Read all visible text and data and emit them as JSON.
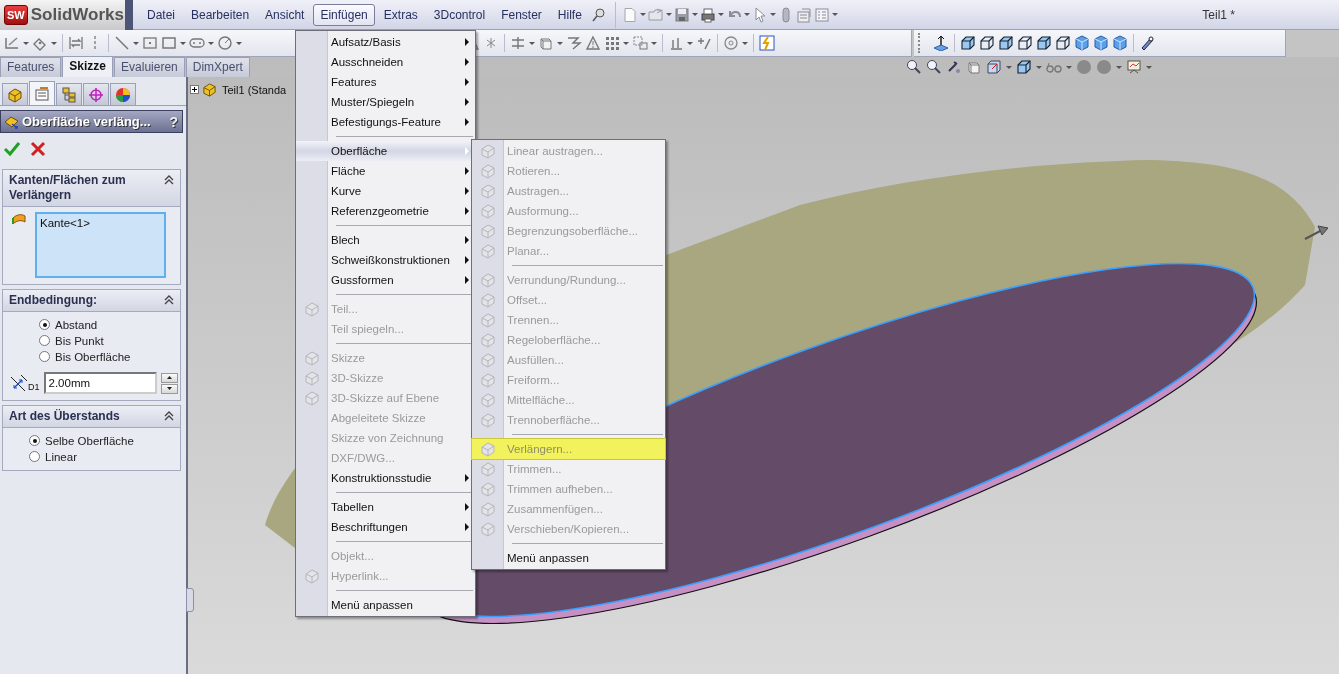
{
  "app": {
    "logo_mark": "SW",
    "logo_text": "SolidWorks",
    "document_title": "Teil1 *"
  },
  "menu_bar": [
    {
      "label": "Datei",
      "selected": false
    },
    {
      "label": "Bearbeiten",
      "selected": false
    },
    {
      "label": "Ansicht",
      "selected": false
    },
    {
      "label": "Einfügen",
      "selected": true
    },
    {
      "label": "Extras",
      "selected": false
    },
    {
      "label": "3Dcontrol",
      "selected": false
    },
    {
      "label": "Fenster",
      "selected": false
    },
    {
      "label": "Hilfe",
      "selected": false
    }
  ],
  "command_tabs": [
    {
      "label": "Features",
      "selected": false
    },
    {
      "label": "Skizze",
      "selected": true
    },
    {
      "label": "Evaluieren",
      "selected": false
    },
    {
      "label": "DimXpert",
      "selected": false
    }
  ],
  "feature_tree": [
    {
      "label": "Teil1 (Standa",
      "expanded": false
    }
  ],
  "property_manager": {
    "tabs": [
      {
        "selected": false
      },
      {
        "selected": true
      },
      {
        "selected": false
      },
      {
        "selected": false
      },
      {
        "selected": false
      }
    ],
    "title": "Oberfläche verläng...",
    "help": "?",
    "sections": [
      {
        "kind": "selection",
        "title": "Kanten/Flächen zum Verlängern",
        "expanded": true,
        "items": [
          "Kante<1>"
        ]
      },
      {
        "kind": "options",
        "title": "Endbedingung:",
        "expanded": true,
        "options": [
          {
            "label": "Abstand",
            "selected": true
          },
          {
            "label": "Bis Punkt",
            "selected": false
          },
          {
            "label": "Bis Oberfläche",
            "selected": false
          }
        ],
        "spinner": {
          "icon_label": "D1",
          "value": "2.00mm"
        }
      },
      {
        "kind": "options",
        "title": "Art des Überstands",
        "expanded": true,
        "options": [
          {
            "label": "Selbe Oberfläche",
            "selected": true
          },
          {
            "label": "Linear",
            "selected": false
          }
        ]
      }
    ]
  },
  "insert_menu": {
    "items": [
      {
        "kind": "item",
        "label": "Aufsatz/Basis",
        "submenu": true,
        "disabled": false,
        "selected": false,
        "icon": false
      },
      {
        "kind": "item",
        "label": "Ausschneiden",
        "submenu": true,
        "disabled": false,
        "selected": false,
        "icon": false
      },
      {
        "kind": "item",
        "label": "Features",
        "submenu": true,
        "disabled": false,
        "selected": false,
        "icon": false
      },
      {
        "kind": "item",
        "label": "Muster/Spiegeln",
        "submenu": true,
        "disabled": false,
        "selected": false,
        "icon": false
      },
      {
        "kind": "item",
        "label": "Befestigungs-Feature",
        "submenu": true,
        "disabled": false,
        "selected": false,
        "icon": false
      },
      {
        "kind": "separator"
      },
      {
        "kind": "item",
        "label": "Oberfläche",
        "submenu": true,
        "disabled": false,
        "selected": true,
        "icon": false
      },
      {
        "kind": "item",
        "label": "Fläche",
        "submenu": true,
        "disabled": false,
        "selected": false,
        "icon": false
      },
      {
        "kind": "item",
        "label": "Kurve",
        "submenu": true,
        "disabled": false,
        "selected": false,
        "icon": false
      },
      {
        "kind": "item",
        "label": "Referenzgeometrie",
        "submenu": true,
        "disabled": false,
        "selected": false,
        "icon": false
      },
      {
        "kind": "separator"
      },
      {
        "kind": "item",
        "label": "Blech",
        "submenu": true,
        "disabled": false,
        "selected": false,
        "icon": false
      },
      {
        "kind": "item",
        "label": "Schweißkonstruktionen",
        "submenu": true,
        "disabled": false,
        "selected": false,
        "icon": false
      },
      {
        "kind": "item",
        "label": "Gussformen",
        "submenu": true,
        "disabled": false,
        "selected": false,
        "icon": false
      },
      {
        "kind": "separator"
      },
      {
        "kind": "item",
        "label": "Teil...",
        "submenu": false,
        "disabled": true,
        "selected": false,
        "icon": true
      },
      {
        "kind": "item",
        "label": "Teil spiegeln...",
        "submenu": false,
        "disabled": true,
        "selected": false,
        "icon": false
      },
      {
        "kind": "separator"
      },
      {
        "kind": "item",
        "label": "Skizze",
        "submenu": false,
        "disabled": true,
        "selected": false,
        "icon": true
      },
      {
        "kind": "item",
        "label": "3D-Skizze",
        "submenu": false,
        "disabled": true,
        "selected": false,
        "icon": true
      },
      {
        "kind": "item",
        "label": "3D-Skizze auf Ebene",
        "submenu": false,
        "disabled": true,
        "selected": false,
        "icon": true
      },
      {
        "kind": "item",
        "label": "Abgeleitete Skizze",
        "submenu": false,
        "disabled": true,
        "selected": false,
        "icon": false
      },
      {
        "kind": "item",
        "label": "Skizze von Zeichnung",
        "submenu": false,
        "disabled": true,
        "selected": false,
        "icon": false
      },
      {
        "kind": "item",
        "label": "DXF/DWG...",
        "submenu": false,
        "disabled": true,
        "selected": false,
        "icon": false
      },
      {
        "kind": "item",
        "label": "Konstruktionsstudie",
        "submenu": true,
        "disabled": false,
        "selected": false,
        "icon": false
      },
      {
        "kind": "separator"
      },
      {
        "kind": "item",
        "label": "Tabellen",
        "submenu": true,
        "disabled": false,
        "selected": false,
        "icon": false
      },
      {
        "kind": "item",
        "label": "Beschriftungen",
        "submenu": true,
        "disabled": false,
        "selected": false,
        "icon": false
      },
      {
        "kind": "separator"
      },
      {
        "kind": "item",
        "label": "Objekt...",
        "submenu": false,
        "disabled": true,
        "selected": false,
        "icon": false
      },
      {
        "kind": "item",
        "label": "Hyperlink...",
        "submenu": false,
        "disabled": true,
        "selected": false,
        "icon": true
      },
      {
        "kind": "separator"
      },
      {
        "kind": "item",
        "label": "Menü anpassen",
        "submenu": false,
        "disabled": false,
        "selected": false,
        "icon": false
      }
    ]
  },
  "surface_submenu": {
    "items": [
      {
        "kind": "item",
        "label": "Linear austragen...",
        "submenu": false,
        "disabled": true,
        "selected": false,
        "icon": true
      },
      {
        "kind": "item",
        "label": "Rotieren...",
        "submenu": false,
        "disabled": true,
        "selected": false,
        "icon": true
      },
      {
        "kind": "item",
        "label": "Austragen...",
        "submenu": false,
        "disabled": true,
        "selected": false,
        "icon": true
      },
      {
        "kind": "item",
        "label": "Ausformung...",
        "submenu": false,
        "disabled": true,
        "selected": false,
        "icon": true
      },
      {
        "kind": "item",
        "label": "Begrenzungsoberfläche...",
        "submenu": false,
        "disabled": true,
        "selected": false,
        "icon": true
      },
      {
        "kind": "item",
        "label": "Planar...",
        "submenu": false,
        "disabled": true,
        "selected": false,
        "icon": true
      },
      {
        "kind": "separator"
      },
      {
        "kind": "item",
        "label": "Verrundung/Rundung...",
        "submenu": false,
        "disabled": true,
        "selected": false,
        "icon": true
      },
      {
        "kind": "item",
        "label": "Offset...",
        "submenu": false,
        "disabled": true,
        "selected": false,
        "icon": true
      },
      {
        "kind": "item",
        "label": "Trennen...",
        "submenu": false,
        "disabled": true,
        "selected": false,
        "icon": true
      },
      {
        "kind": "item",
        "label": "Regeloberfläche...",
        "submenu": false,
        "disabled": true,
        "selected": false,
        "icon": true
      },
      {
        "kind": "item",
        "label": "Ausfüllen...",
        "submenu": false,
        "disabled": true,
        "selected": false,
        "icon": true
      },
      {
        "kind": "item",
        "label": "Freiform...",
        "submenu": false,
        "disabled": true,
        "selected": false,
        "icon": true
      },
      {
        "kind": "item",
        "label": "Mittelfläche...",
        "submenu": false,
        "disabled": true,
        "selected": false,
        "icon": true
      },
      {
        "kind": "item",
        "label": "Trennoberfläche...",
        "submenu": false,
        "disabled": true,
        "selected": false,
        "icon": true
      },
      {
        "kind": "separator"
      },
      {
        "kind": "item",
        "label": "Verlängern...",
        "submenu": false,
        "disabled": true,
        "selected": true,
        "icon": true
      },
      {
        "kind": "item",
        "label": "Trimmen...",
        "submenu": false,
        "disabled": true,
        "selected": false,
        "icon": true
      },
      {
        "kind": "item",
        "label": "Trimmen aufheben...",
        "submenu": false,
        "disabled": true,
        "selected": false,
        "icon": true
      },
      {
        "kind": "item",
        "label": "Zusammenfügen...",
        "submenu": false,
        "disabled": true,
        "selected": false,
        "icon": true
      },
      {
        "kind": "item",
        "label": "Verschieben/Kopieren...",
        "submenu": false,
        "disabled": true,
        "selected": false,
        "icon": true
      },
      {
        "kind": "separator"
      },
      {
        "kind": "item",
        "label": "Menü anpassen",
        "submenu": false,
        "disabled": false,
        "selected": false,
        "icon": false
      }
    ]
  }
}
